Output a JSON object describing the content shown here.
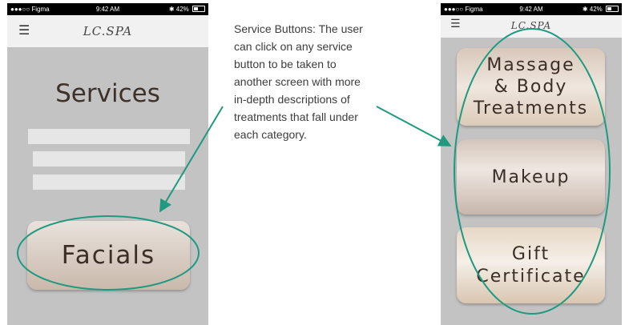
{
  "status_bar_left": {
    "carrier": "●●●○○ Figma",
    "time": "9:42 AM",
    "battery": "42%"
  },
  "status_bar_right": {
    "carrier": "●●●○○ Figma",
    "time": "9:42 AM",
    "battery": "42%"
  },
  "left_screen": {
    "logo": "LC.SPA",
    "menu_icon": "menu-icon",
    "title": "Services",
    "placeholder_bars": 3,
    "facials_label": "Facials"
  },
  "right_screen": {
    "logo": "LC.SPA",
    "menu_icon": "menu-icon",
    "buttons": [
      {
        "label_line1": "Massage",
        "label_line2": "& Body",
        "label_line3": "Treatments"
      },
      {
        "label_line1": "Makeup"
      },
      {
        "label_line1": "Gift",
        "label_line2": "Certificate"
      }
    ]
  },
  "annotation": {
    "text": "Service Buttons: The user can click on any service button to be taken to another screen with more in-depth descriptions of treatments that fall under each category."
  },
  "colors": {
    "screen_background": "#c3c3c3",
    "appbar": "#f1f1f1",
    "annotation_stroke": "#1f9a7e",
    "title_text": "#3d3128"
  }
}
